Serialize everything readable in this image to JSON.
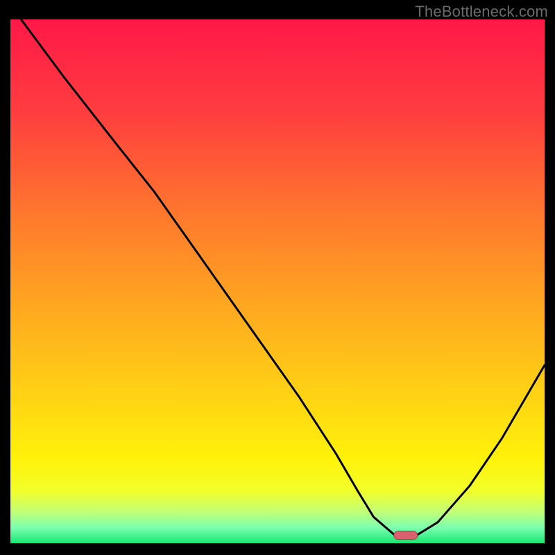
{
  "watermark": "TheBottleneck.com",
  "chart_data": {
    "type": "line",
    "title": "",
    "xlabel": "",
    "ylabel": "",
    "xlim": [
      0,
      100
    ],
    "ylim": [
      0,
      100
    ],
    "series": [
      {
        "name": "curve",
        "x": [
          2,
          10,
          20,
          27,
          36,
          45,
          54,
          61,
          65,
          68,
          72,
          76,
          80,
          86,
          92,
          100
        ],
        "y": [
          100,
          89,
          76,
          67,
          54,
          41,
          28,
          17,
          10,
          5,
          1.5,
          1.5,
          4,
          11,
          20,
          34
        ]
      }
    ],
    "marker": {
      "x": 74,
      "y": 1.5
    },
    "gradient_stops": [
      {
        "offset": 0,
        "color": "#ff1848"
      },
      {
        "offset": 18,
        "color": "#ff3e3f"
      },
      {
        "offset": 38,
        "color": "#ff7a2c"
      },
      {
        "offset": 55,
        "color": "#ffa820"
      },
      {
        "offset": 72,
        "color": "#ffd314"
      },
      {
        "offset": 84,
        "color": "#fff20a"
      },
      {
        "offset": 90,
        "color": "#f2ff2a"
      },
      {
        "offset": 94,
        "color": "#c2ff77"
      },
      {
        "offset": 97,
        "color": "#7dffb0"
      },
      {
        "offset": 100,
        "color": "#19e672"
      }
    ],
    "colors": {
      "frame": "#000000",
      "line": "#000000",
      "marker_fill": "#d9606e",
      "marker_stroke": "#a63a49"
    }
  }
}
